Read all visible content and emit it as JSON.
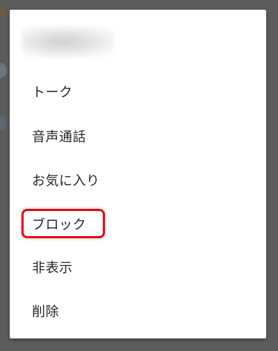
{
  "menu": {
    "items": [
      {
        "id": "talk",
        "label": "トーク"
      },
      {
        "id": "voice-call",
        "label": "音声通話"
      },
      {
        "id": "favorite",
        "label": "お気に入り"
      },
      {
        "id": "block",
        "label": "ブロック",
        "highlighted": true
      },
      {
        "id": "hide",
        "label": "非表示"
      },
      {
        "id": "delete",
        "label": "削除"
      }
    ]
  },
  "colors": {
    "overlay": "#5c5c5c",
    "menu_background": "#ffffff",
    "text": "#262626",
    "highlight": "#e8000f"
  }
}
